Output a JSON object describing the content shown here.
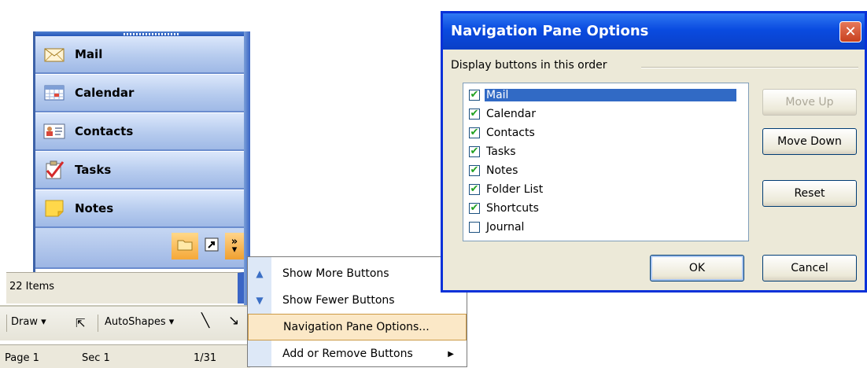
{
  "nav_pane": {
    "buttons": [
      {
        "label": "Mail",
        "icon": "mail-envelope-icon"
      },
      {
        "label": "Calendar",
        "icon": "calendar-icon"
      },
      {
        "label": "Contacts",
        "icon": "contact-card-icon"
      },
      {
        "label": "Tasks",
        "icon": "task-checkmark-icon"
      },
      {
        "label": "Notes",
        "icon": "sticky-note-icon"
      }
    ],
    "bottom_icons": [
      "folder-icon",
      "shortcut-icon",
      "configure-buttons-icon"
    ],
    "status": "22 Items"
  },
  "context_menu": {
    "items": [
      {
        "label": "Show More Buttons",
        "mnemonic": "M"
      },
      {
        "label": "Show Fewer Buttons",
        "mnemonic": "F"
      },
      {
        "label": "Navigation Pane Options...",
        "mnemonic": "v"
      },
      {
        "label": "Add or Remove Buttons",
        "mnemonic": ""
      }
    ]
  },
  "drawing_toolbar": {
    "draw_label": "Draw",
    "autoshapes_label": "AutoShapes"
  },
  "page_status": {
    "page": "Page 1",
    "section": "Sec 1",
    "count": "1/31"
  },
  "dialog": {
    "title": "Navigation Pane Options",
    "group_label": "Display buttons in this order",
    "items": [
      {
        "label": "Mail",
        "checked": true,
        "selected": true
      },
      {
        "label": "Calendar",
        "checked": true,
        "selected": false
      },
      {
        "label": "Contacts",
        "checked": true,
        "selected": false
      },
      {
        "label": "Tasks",
        "checked": true,
        "selected": false
      },
      {
        "label": "Notes",
        "checked": true,
        "selected": false
      },
      {
        "label": "Folder List",
        "checked": true,
        "selected": false
      },
      {
        "label": "Shortcuts",
        "checked": true,
        "selected": false
      },
      {
        "label": "Journal",
        "checked": false,
        "selected": false
      }
    ],
    "buttons": {
      "move_up": "Move Up",
      "move_down": "Move Down",
      "reset": "Reset",
      "ok": "OK",
      "cancel": "Cancel"
    }
  },
  "colors": {
    "titlebar": "#0a4be0",
    "selection": "#316ac5",
    "menu_highlight": "#fbe8c7",
    "check_green": "#21a121"
  }
}
